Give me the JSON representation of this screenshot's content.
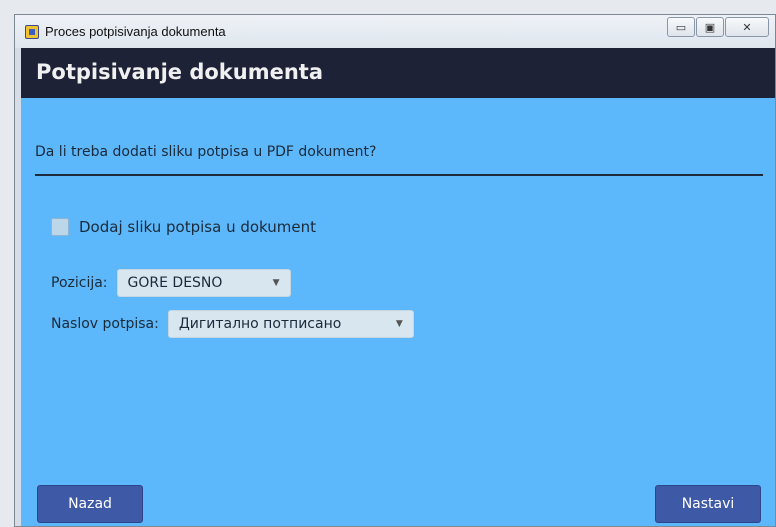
{
  "window": {
    "title": "Proces potpisivanja dokumenta",
    "controls": {
      "minimize": "▭",
      "maximize": "▣",
      "close": "✕"
    }
  },
  "header": {
    "title": "Potpisivanje dokumenta"
  },
  "content": {
    "question": "Da li treba dodati sliku potpisa u PDF dokument?",
    "checkbox": {
      "label": "Dodaj sliku potpisa u dokument",
      "checked": false
    },
    "position": {
      "label": "Pozicija:",
      "value": "GORE DESNO"
    },
    "signature_title": {
      "label": "Naslov potpisa:",
      "value": "Дигитално потписано"
    }
  },
  "footer": {
    "back_label": "Nazad",
    "next_label": "Nastavi"
  },
  "icons": {
    "dropdown": "▼"
  },
  "colors": {
    "header_bg": "#1d2237",
    "content_bg": "#5cb8fb",
    "button_bg": "#3e5aa6"
  }
}
